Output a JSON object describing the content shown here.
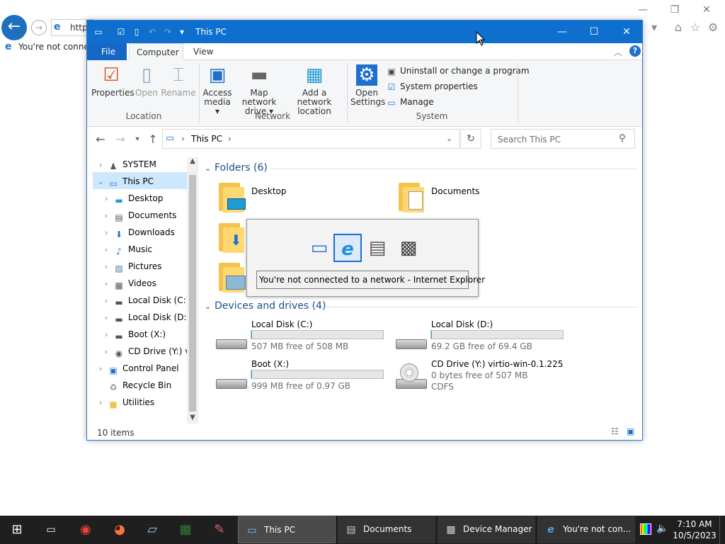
{
  "ie": {
    "address": "https",
    "tab_title": "You're not connec",
    "icons": [
      "back-arrow-icon",
      "forward-arrow-icon",
      "ie-logo-icon",
      "home-icon",
      "favorites-star-icon",
      "settings-gear-icon"
    ]
  },
  "explorer": {
    "title": "This PC",
    "ribbon_tabs": {
      "file": "File",
      "computer": "Computer",
      "view": "View"
    },
    "ribbon": {
      "properties": "Properties",
      "open": "Open",
      "rename": "Rename",
      "group_location": "Location",
      "access_media": "Access media",
      "map_network_drive": "Map network drive",
      "add_network_location": "Add a network location",
      "group_network": "Network",
      "open_settings": "Open Settings",
      "uninstall": "Uninstall or change a program",
      "system_properties": "System properties",
      "manage": "Manage",
      "group_system": "System"
    },
    "address_path": "This PC",
    "search_placeholder": "Search This PC",
    "tree": [
      {
        "label": "SYSTEM",
        "icon": "user-icon",
        "indent": 0,
        "expanded": false,
        "selected": false
      },
      {
        "label": "This PC",
        "icon": "computer-icon",
        "indent": 0,
        "expanded": true,
        "selected": true
      },
      {
        "label": "Desktop",
        "icon": "desktop-icon",
        "indent": 1,
        "expanded": false,
        "selected": false
      },
      {
        "label": "Documents",
        "icon": "documents-icon",
        "indent": 1,
        "expanded": false,
        "selected": false
      },
      {
        "label": "Downloads",
        "icon": "downloads-icon",
        "indent": 1,
        "expanded": false,
        "selected": false
      },
      {
        "label": "Music",
        "icon": "music-icon",
        "indent": 1,
        "expanded": false,
        "selected": false
      },
      {
        "label": "Pictures",
        "icon": "pictures-icon",
        "indent": 1,
        "expanded": false,
        "selected": false
      },
      {
        "label": "Videos",
        "icon": "videos-icon",
        "indent": 1,
        "expanded": false,
        "selected": false
      },
      {
        "label": "Local Disk (C:)",
        "icon": "drive-icon",
        "indent": 1,
        "expanded": false,
        "selected": false
      },
      {
        "label": "Local Disk (D:)",
        "icon": "drive-icon",
        "indent": 1,
        "expanded": false,
        "selected": false
      },
      {
        "label": "Boot (X:)",
        "icon": "drive-icon",
        "indent": 1,
        "expanded": false,
        "selected": false
      },
      {
        "label": "CD Drive (Y:) vi",
        "icon": "cd-drive-icon",
        "indent": 1,
        "expanded": false,
        "selected": false
      },
      {
        "label": "Control Panel",
        "icon": "control-panel-icon",
        "indent": 0,
        "expanded": false,
        "selected": false
      },
      {
        "label": "Recycle Bin",
        "icon": "recycle-bin-icon",
        "indent": 0,
        "expanded": null,
        "selected": false
      },
      {
        "label": "Utilities",
        "icon": "folder-icon",
        "indent": 0,
        "expanded": false,
        "selected": false
      }
    ],
    "folders_header": "Folders (6)",
    "folders": [
      {
        "label": "Desktop",
        "overlay": "desktop-icon"
      },
      {
        "label": "Documents",
        "overlay": "documents-icon"
      },
      {
        "label": "",
        "overlay": "downloads-icon"
      },
      {
        "label": "",
        "overlay": ""
      },
      {
        "label": "",
        "overlay": "pictures-icon"
      },
      {
        "label": "",
        "overlay": ""
      }
    ],
    "drives_header": "Devices and drives (4)",
    "drives": [
      {
        "name": "Local Disk (C:)",
        "free": "507 MB free of 508 MB",
        "used_fraction": 0.002,
        "icon": "hard-drive-icon"
      },
      {
        "name": "Local Disk (D:)",
        "free": "69.2 GB free of 69.4 GB",
        "used_fraction": 0.003,
        "icon": "hard-drive-icon"
      },
      {
        "name": "Boot (X:)",
        "free": "999 MB free of 0.97 GB",
        "used_fraction": 0.0,
        "icon": "hard-drive-icon"
      },
      {
        "name": "CD Drive (Y:) virtio-win-0.1.225",
        "free": "0 bytes free of 507 MB",
        "extra": "CDFS",
        "used_fraction": null,
        "icon": "cd-drive-icon"
      }
    ],
    "status": "10 items"
  },
  "alttab": {
    "label": "You're not connected to a network - Internet Explorer",
    "icons": [
      "this-pc-icon",
      "internet-explorer-icon",
      "documents-icon",
      "device-manager-icon"
    ],
    "selected_index": 1
  },
  "taskbar": {
    "pinned": [
      "start-icon",
      "terminal-icon",
      "chrome-icon",
      "firefox-icon",
      "notepad-icon",
      "spreadsheet-icon",
      "paint-icon"
    ],
    "apps": [
      {
        "label": "This PC",
        "icon": "this-pc-icon",
        "active": true
      },
      {
        "label": "Documents",
        "icon": "documents-icon",
        "active": false
      },
      {
        "label": "Device Manager",
        "icon": "device-manager-icon",
        "active": false
      },
      {
        "label": "You're not con...",
        "icon": "internet-explorer-icon",
        "active": false
      }
    ],
    "time": "7:10 AM",
    "date": "10/5/2023"
  }
}
